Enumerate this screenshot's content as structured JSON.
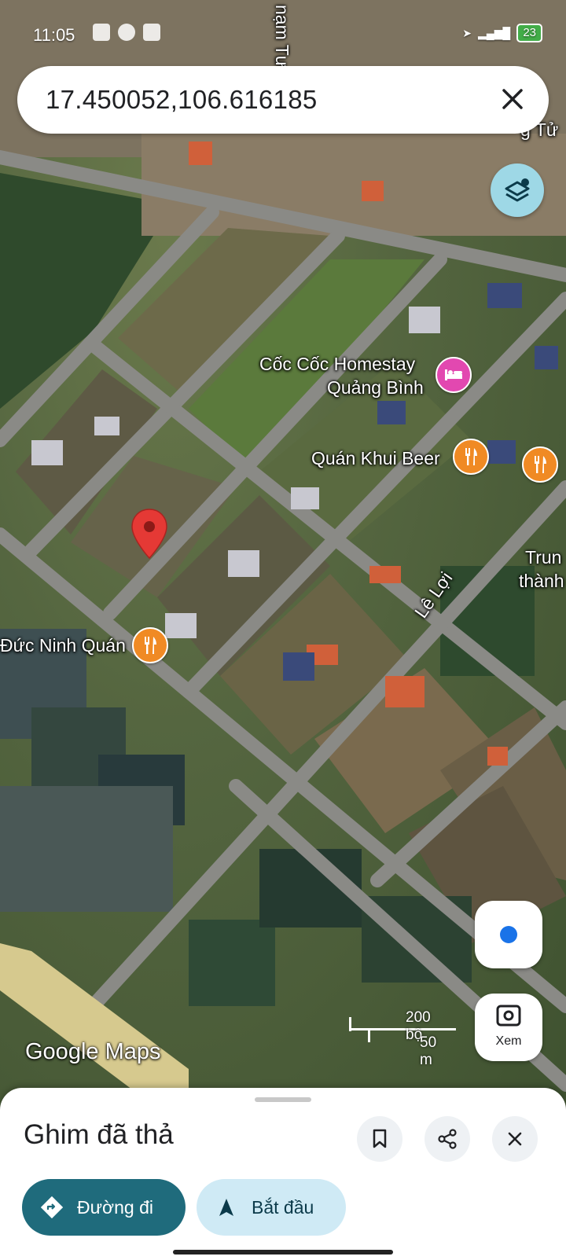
{
  "status_bar": {
    "time": "11:05",
    "battery": "23"
  },
  "search": {
    "query": "17.450052,106.616185"
  },
  "map": {
    "street_labels": [
      "nạm Tư",
      "Lê Lợi",
      "g Tử",
      "Trun",
      "thành"
    ],
    "places": [
      {
        "name": "Cốc Cốc Homestay",
        "name2": "Quảng Bình",
        "icon": "hotel-icon"
      },
      {
        "name": "Quán Khui Beer",
        "icon": "restaurant-icon"
      },
      {
        "name": "Đức Ninh Quán",
        "icon": "restaurant-icon"
      }
    ],
    "scale": {
      "feet": "200 bộ",
      "meters": "50 m"
    },
    "attribution": "Google Maps",
    "view_button_label": "Xem"
  },
  "sheet": {
    "title": "Ghim đã thả",
    "directions_label": "Đường đi",
    "start_label": "Bắt đầu"
  },
  "colors": {
    "directions_bg": "#1f6b7c",
    "start_bg": "#cfeaf5",
    "pin": "#e53935",
    "poi_food": "#f08a24",
    "poi_hotel": "#e248b0"
  }
}
